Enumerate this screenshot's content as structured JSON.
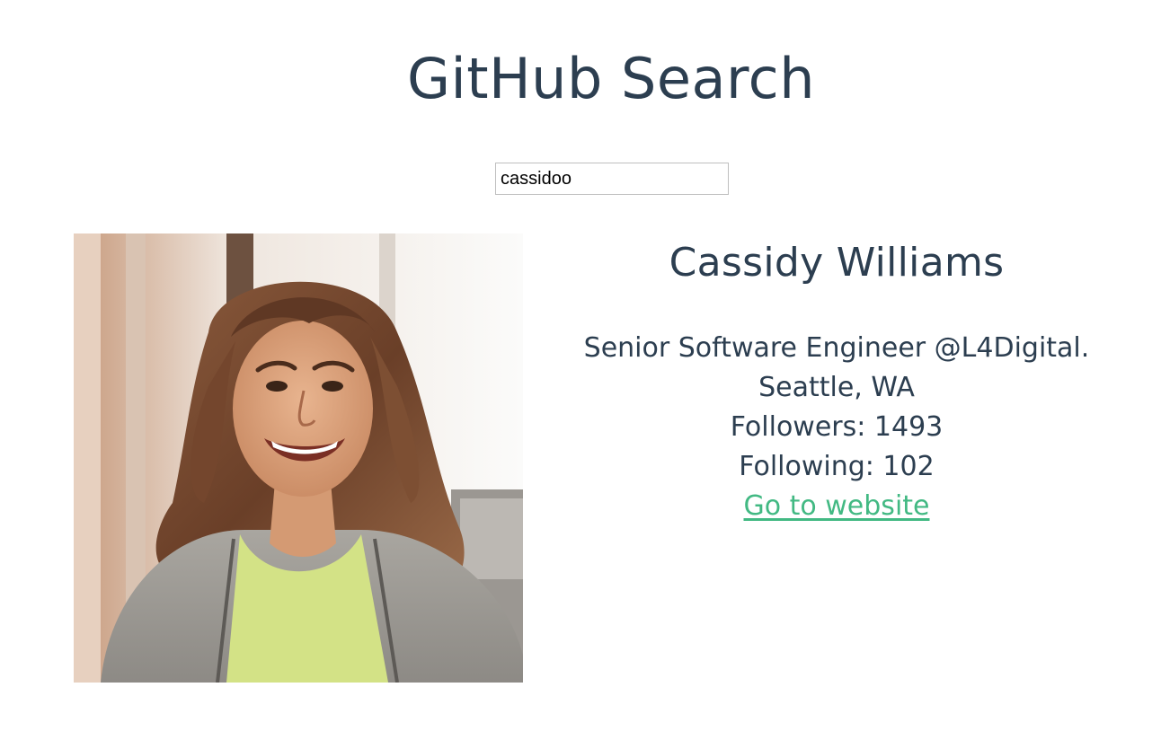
{
  "header": {
    "title": "GitHub Search"
  },
  "search": {
    "value": "cassidoo"
  },
  "profile": {
    "avatar_alt": "Cassidy Williams avatar",
    "name": "Cassidy Williams",
    "bio": "Senior Software Engineer @L4Digital.",
    "location": "Seattle, WA",
    "followers_label": "Followers: 1493",
    "following_label": "Following: 102",
    "website_link": "Go to website"
  },
  "colors": {
    "text": "#2c3e50",
    "link": "#42b983",
    "input_border": "#bfbfbf"
  }
}
